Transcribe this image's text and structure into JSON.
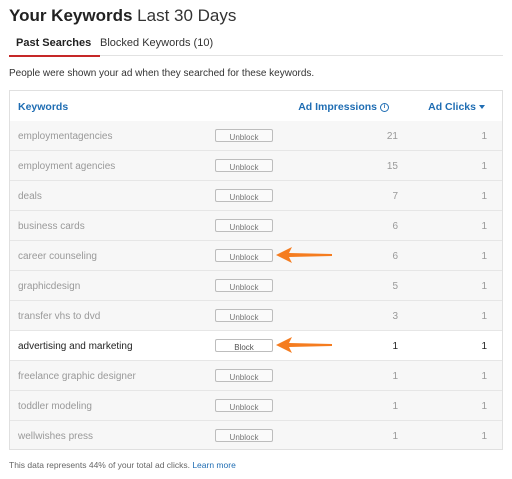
{
  "header": {
    "title_bold": "Your Keywords",
    "title_rest": "Last 30 Days"
  },
  "tabs": [
    {
      "label": "Past Searches",
      "active": true
    },
    {
      "label": "Blocked Keywords (10)",
      "active": false
    }
  ],
  "description": "People were shown your ad when they searched for these keywords.",
  "table": {
    "headers": {
      "keywords": "Keywords",
      "impressions": "Ad Impressions",
      "clicks": "Ad Clicks"
    },
    "rows": [
      {
        "keyword": "employmentagencies",
        "action": "Unblock",
        "impressions": "21",
        "clicks": "1"
      },
      {
        "keyword": "employment agencies",
        "action": "Unblock",
        "impressions": "15",
        "clicks": "1"
      },
      {
        "keyword": "deals",
        "action": "Unblock",
        "impressions": "7",
        "clicks": "1"
      },
      {
        "keyword": "business cards",
        "action": "Unblock",
        "impressions": "6",
        "clicks": "1"
      },
      {
        "keyword": "career counseling",
        "action": "Unblock",
        "impressions": "6",
        "clicks": "1"
      },
      {
        "keyword": "graphicdesign",
        "action": "Unblock",
        "impressions": "5",
        "clicks": "1"
      },
      {
        "keyword": "transfer vhs to dvd",
        "action": "Unblock",
        "impressions": "3",
        "clicks": "1"
      },
      {
        "keyword": "advertising and marketing",
        "action": "Block",
        "impressions": "1",
        "clicks": "1"
      },
      {
        "keyword": "freelance graphic designer",
        "action": "Unblock",
        "impressions": "1",
        "clicks": "1"
      },
      {
        "keyword": "toddler modeling",
        "action": "Unblock",
        "impressions": "1",
        "clicks": "1"
      },
      {
        "keyword": "wellwishes press",
        "action": "Unblock",
        "impressions": "1",
        "clicks": "1"
      }
    ]
  },
  "footer": {
    "text": "This data represents 44% of your total ad clicks.",
    "link": "Learn more"
  },
  "colors": {
    "accent": "#1f6db3",
    "tab_underline": "#c62828",
    "arrow": "#f57c1f"
  }
}
